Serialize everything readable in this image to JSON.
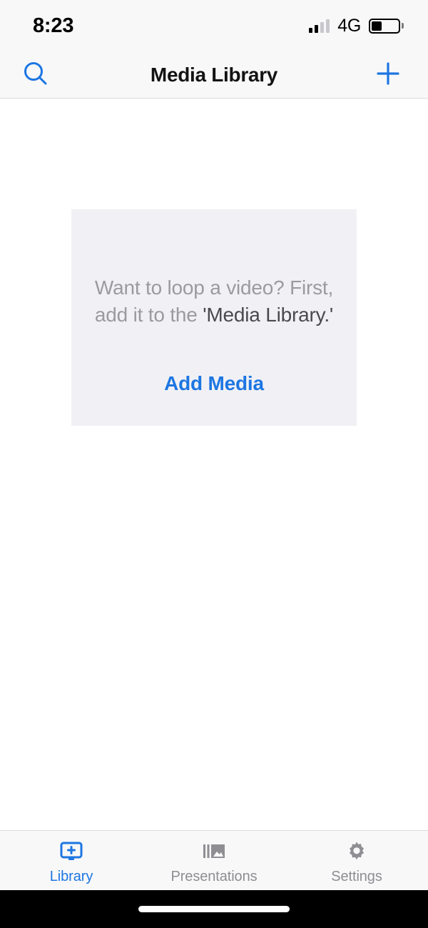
{
  "status_bar": {
    "time": "8:23",
    "carrier": "4G",
    "signal_bars_total": 4,
    "signal_bars_filled": 2,
    "battery_percent": 40,
    "battery_fill_color": "#000000"
  },
  "nav_bar": {
    "title": "Media Library",
    "left_icon": "search-icon",
    "right_icon": "plus-icon",
    "tint_color": "#1d76e2"
  },
  "empty_state": {
    "message_line1": "Want to loop a video? First,",
    "message_line2_prefix": "add it to the ",
    "message_line2_emphasis": "'Media Library.'",
    "action_label": "Add Media",
    "card_background": "#f1f1f5",
    "text_color": "#9a9a9f",
    "emphasis_color": "#4a4a4e",
    "action_color": "#1d76e2"
  },
  "tab_bar": {
    "active_index": 0,
    "active_color": "#1d76e2",
    "inactive_color": "#8e8e93",
    "tabs": [
      {
        "label": "Library",
        "icon": "monitor-plus-icon"
      },
      {
        "label": "Presentations",
        "icon": "slideshow-image-icon"
      },
      {
        "label": "Settings",
        "icon": "gear-icon"
      }
    ]
  }
}
